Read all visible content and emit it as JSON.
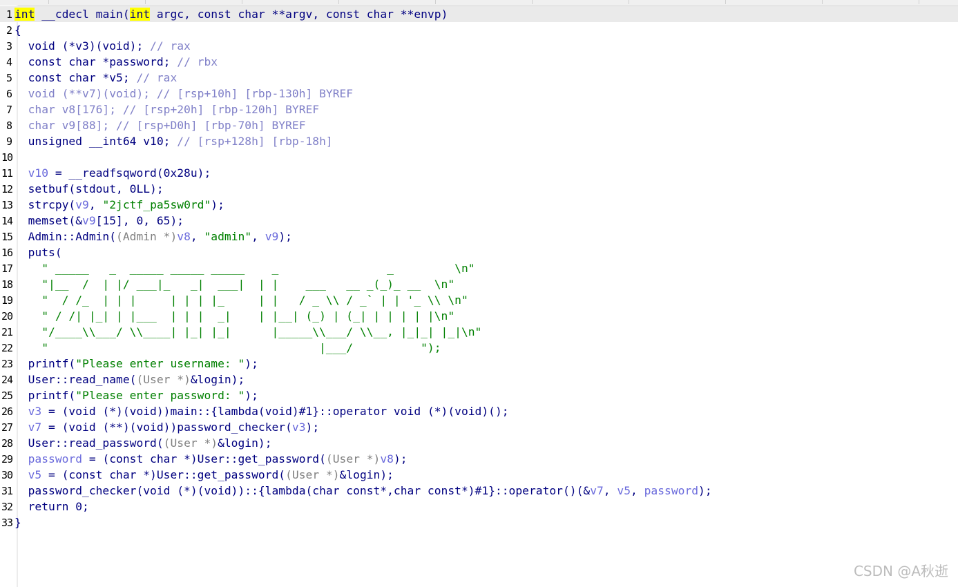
{
  "editor": {
    "lines": [
      {
        "n": "1",
        "parts": [
          [
            "yel",
            "int"
          ],
          [
            "kw",
            " __cdecl main("
          ],
          [
            "yel",
            "int"
          ],
          [
            "kw",
            " argc, const char **argv, const char **envp)"
          ]
        ]
      },
      {
        "n": "2",
        "parts": [
          [
            "kw",
            "{"
          ]
        ]
      },
      {
        "n": "3",
        "parts": [
          [
            "kw",
            "  void (*v3)(void); "
          ],
          [
            "cm",
            "// rax"
          ]
        ]
      },
      {
        "n": "4",
        "parts": [
          [
            "kw",
            "  const char *password; "
          ],
          [
            "cm",
            "// rbx"
          ]
        ]
      },
      {
        "n": "5",
        "parts": [
          [
            "kw",
            "  const char *v5; "
          ],
          [
            "cm",
            "// rax"
          ]
        ]
      },
      {
        "n": "6",
        "parts": [
          [
            "cm",
            "  void (**v7)(void); // [rsp+10h] [rbp-130h] BYREF"
          ]
        ]
      },
      {
        "n": "7",
        "parts": [
          [
            "cm",
            "  char v8[176]; // [rsp+20h] [rbp-120h] BYREF"
          ]
        ]
      },
      {
        "n": "8",
        "parts": [
          [
            "cm",
            "  char v9[88]; // [rsp+D0h] [rbp-70h] BYREF"
          ]
        ]
      },
      {
        "n": "9",
        "parts": [
          [
            "kw",
            "  unsigned __int64 v10; "
          ],
          [
            "cm",
            "// [rsp+128h] [rbp-18h]"
          ]
        ]
      },
      {
        "n": "10",
        "parts": []
      },
      {
        "n": "11",
        "parts": [
          [
            "var",
            "  v10"
          ],
          [
            "kw",
            " = __readfsqword(0x28u);"
          ]
        ]
      },
      {
        "n": "12",
        "parts": [
          [
            "kw",
            "  setbuf(stdout, 0LL);"
          ]
        ]
      },
      {
        "n": "13",
        "parts": [
          [
            "kw",
            "  strcpy("
          ],
          [
            "var",
            "v9"
          ],
          [
            "kw",
            ", "
          ],
          [
            "str",
            "\"2jctf_pa5sw0rd\""
          ],
          [
            "kw",
            ");"
          ]
        ]
      },
      {
        "n": "14",
        "parts": [
          [
            "kw",
            "  memset(&"
          ],
          [
            "var",
            "v9"
          ],
          [
            "kw",
            "[15], 0, 65);"
          ]
        ]
      },
      {
        "n": "15",
        "parts": [
          [
            "kw",
            "  Admin::Admin("
          ],
          [
            "cast",
            "(Admin *)"
          ],
          [
            "var",
            "v8"
          ],
          [
            "kw",
            ", "
          ],
          [
            "str",
            "\"admin\""
          ],
          [
            "kw",
            ", "
          ],
          [
            "var",
            "v9"
          ],
          [
            "kw",
            ");"
          ]
        ]
      },
      {
        "n": "16",
        "parts": [
          [
            "kw",
            "  puts("
          ]
        ]
      },
      {
        "n": "17",
        "parts": [
          [
            "str",
            "    \" _____   _  _____ _____ _____    _                _         \\n\""
          ]
        ]
      },
      {
        "n": "18",
        "parts": [
          [
            "str",
            "    \"|__  /  | |/ ___|_   _|  ___|  | |    ___   __ _(_)_ __  \\n\""
          ]
        ]
      },
      {
        "n": "19",
        "parts": [
          [
            "str",
            "    \"  / /_  | | |     | | | |_     | |   / _ \\\\ / _` | | '_ \\\\ \\n\""
          ]
        ]
      },
      {
        "n": "20",
        "parts": [
          [
            "str",
            "    \" / /| |_| | |___  | | |  _|    | |__| (_) | (_| | | | | |\\n\""
          ]
        ]
      },
      {
        "n": "21",
        "parts": [
          [
            "str",
            "    \"/____\\\\___/ \\\\____| |_| |_|      |_____\\\\___/ \\\\__, |_|_| |_|\\n\""
          ]
        ]
      },
      {
        "n": "22",
        "parts": [
          [
            "str",
            "    \"                                        |___/          \");"
          ]
        ]
      },
      {
        "n": "23",
        "parts": [
          [
            "kw",
            "  printf("
          ],
          [
            "str",
            "\"Please enter username: \""
          ],
          [
            "kw",
            ");"
          ]
        ]
      },
      {
        "n": "24",
        "parts": [
          [
            "kw",
            "  User::read_name("
          ],
          [
            "cast",
            "(User *)"
          ],
          [
            "kw",
            "&login);"
          ]
        ]
      },
      {
        "n": "25",
        "parts": [
          [
            "kw",
            "  printf("
          ],
          [
            "str",
            "\"Please enter password: \""
          ],
          [
            "kw",
            ");"
          ]
        ]
      },
      {
        "n": "26",
        "parts": [
          [
            "var",
            "  v3"
          ],
          [
            "kw",
            " = (void (*)(void))main::{lambda(void)#1}::operator void (*)(void)();"
          ]
        ]
      },
      {
        "n": "27",
        "parts": [
          [
            "var",
            "  v7"
          ],
          [
            "kw",
            " = (void (**)(void))password_checker("
          ],
          [
            "var",
            "v3"
          ],
          [
            "kw",
            ");"
          ]
        ]
      },
      {
        "n": "28",
        "parts": [
          [
            "kw",
            "  User::read_password("
          ],
          [
            "cast",
            "(User *)"
          ],
          [
            "kw",
            "&login);"
          ]
        ]
      },
      {
        "n": "29",
        "parts": [
          [
            "var",
            "  password"
          ],
          [
            "kw",
            " = (const char *)User::get_password("
          ],
          [
            "cast",
            "(User *)"
          ],
          [
            "var",
            "v8"
          ],
          [
            "kw",
            ");"
          ]
        ]
      },
      {
        "n": "30",
        "parts": [
          [
            "var",
            "  v5"
          ],
          [
            "kw",
            " = (const char *)User::get_password("
          ],
          [
            "cast",
            "(User *)"
          ],
          [
            "kw",
            "&login);"
          ]
        ]
      },
      {
        "n": "31",
        "parts": [
          [
            "kw",
            "  password_checker(void (*)(void))::{lambda(char const*,char const*)#1}::operator()(&"
          ],
          [
            "var",
            "v7"
          ],
          [
            "kw",
            ", "
          ],
          [
            "var",
            "v5"
          ],
          [
            "kw",
            ", "
          ],
          [
            "var",
            "password"
          ],
          [
            "kw",
            ");"
          ]
        ]
      },
      {
        "n": "32",
        "parts": [
          [
            "kw",
            "  return 0;"
          ]
        ]
      },
      {
        "n": "33",
        "parts": [
          [
            "kw",
            "}"
          ]
        ]
      }
    ]
  },
  "watermark": "CSDN @A秋逝"
}
